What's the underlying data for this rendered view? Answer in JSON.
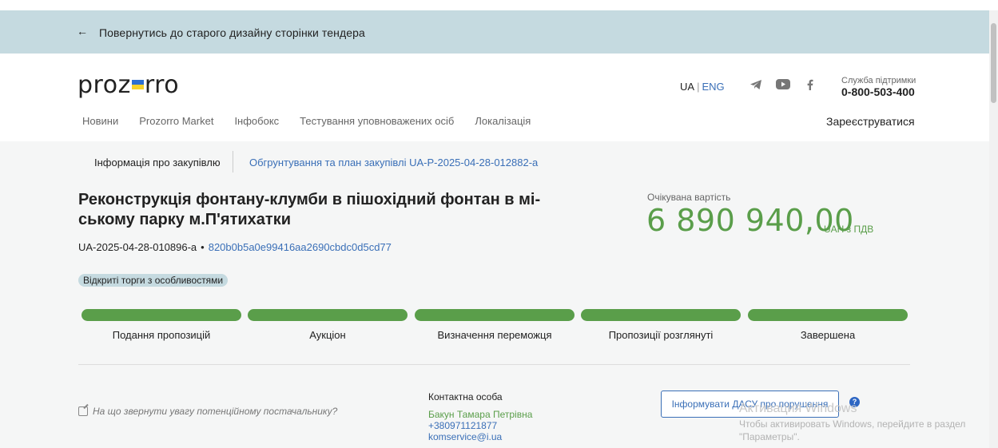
{
  "banner": {
    "text": "Повернутись до старого дизайну сторінки тендера"
  },
  "header": {
    "logo": {
      "left": "proz",
      "right": "rro"
    },
    "lang": {
      "ua": "UA",
      "eng": "ENG"
    },
    "support": {
      "label": "Служба підтримки",
      "phone": "0-800-503-400"
    },
    "nav": [
      "Новини",
      "Prozorro Market",
      "Інфобокс",
      "Тестування уповноважених осіб",
      "Локалізація"
    ],
    "register": "Зареєструватися"
  },
  "tabs": {
    "info": "Інформація про закупівлю",
    "plan": "Обгрунтування та план закупівлі UA-P-2025-04-28-012882-a"
  },
  "tender": {
    "title": "Реконструкція фонтану-клумби в пішохідний фонтан в мі-ському парку м.П'ятихатки",
    "id": "UA-2025-04-28-010896-a",
    "dot": "•",
    "hash": "820b0b5a0e99416aa2690cbdc0d5cd77",
    "procedure": "Відкриті торги з особливостями"
  },
  "expected": {
    "label": "Очікувана вартість",
    "value": "6 890 940,00",
    "currency": "UAH з ПДВ"
  },
  "stages": [
    {
      "label": "Подання пропозицій",
      "done": true
    },
    {
      "label": "Аукціон",
      "done": true
    },
    {
      "label": "Визначення переможця",
      "done": true
    },
    {
      "label": "Пропозиції розглянуті",
      "done": true
    },
    {
      "label": "Завершена",
      "done": true
    }
  ],
  "attention": "На що звернути увагу потенційному постачальнику?",
  "contact": {
    "label": "Контактна особа",
    "name": "Бакун Тамара Петрівна",
    "phone": "+380971121877",
    "email": "komservice@i.ua"
  },
  "report_button": "Інформувати ДАСУ про порушення",
  "help": "?",
  "windows": {
    "title": "Активация Windows",
    "hint_line1": "Чтобы активировать Windows, перейдите в раздел",
    "hint_line2": "\"Параметры\"."
  },
  "colors": {
    "banner": "#c5dae0",
    "accent_green": "#5a9e4a",
    "link_blue": "#3a6fb7",
    "flag_blue": "#2c6fd1",
    "flag_yellow": "#f6d22b"
  }
}
